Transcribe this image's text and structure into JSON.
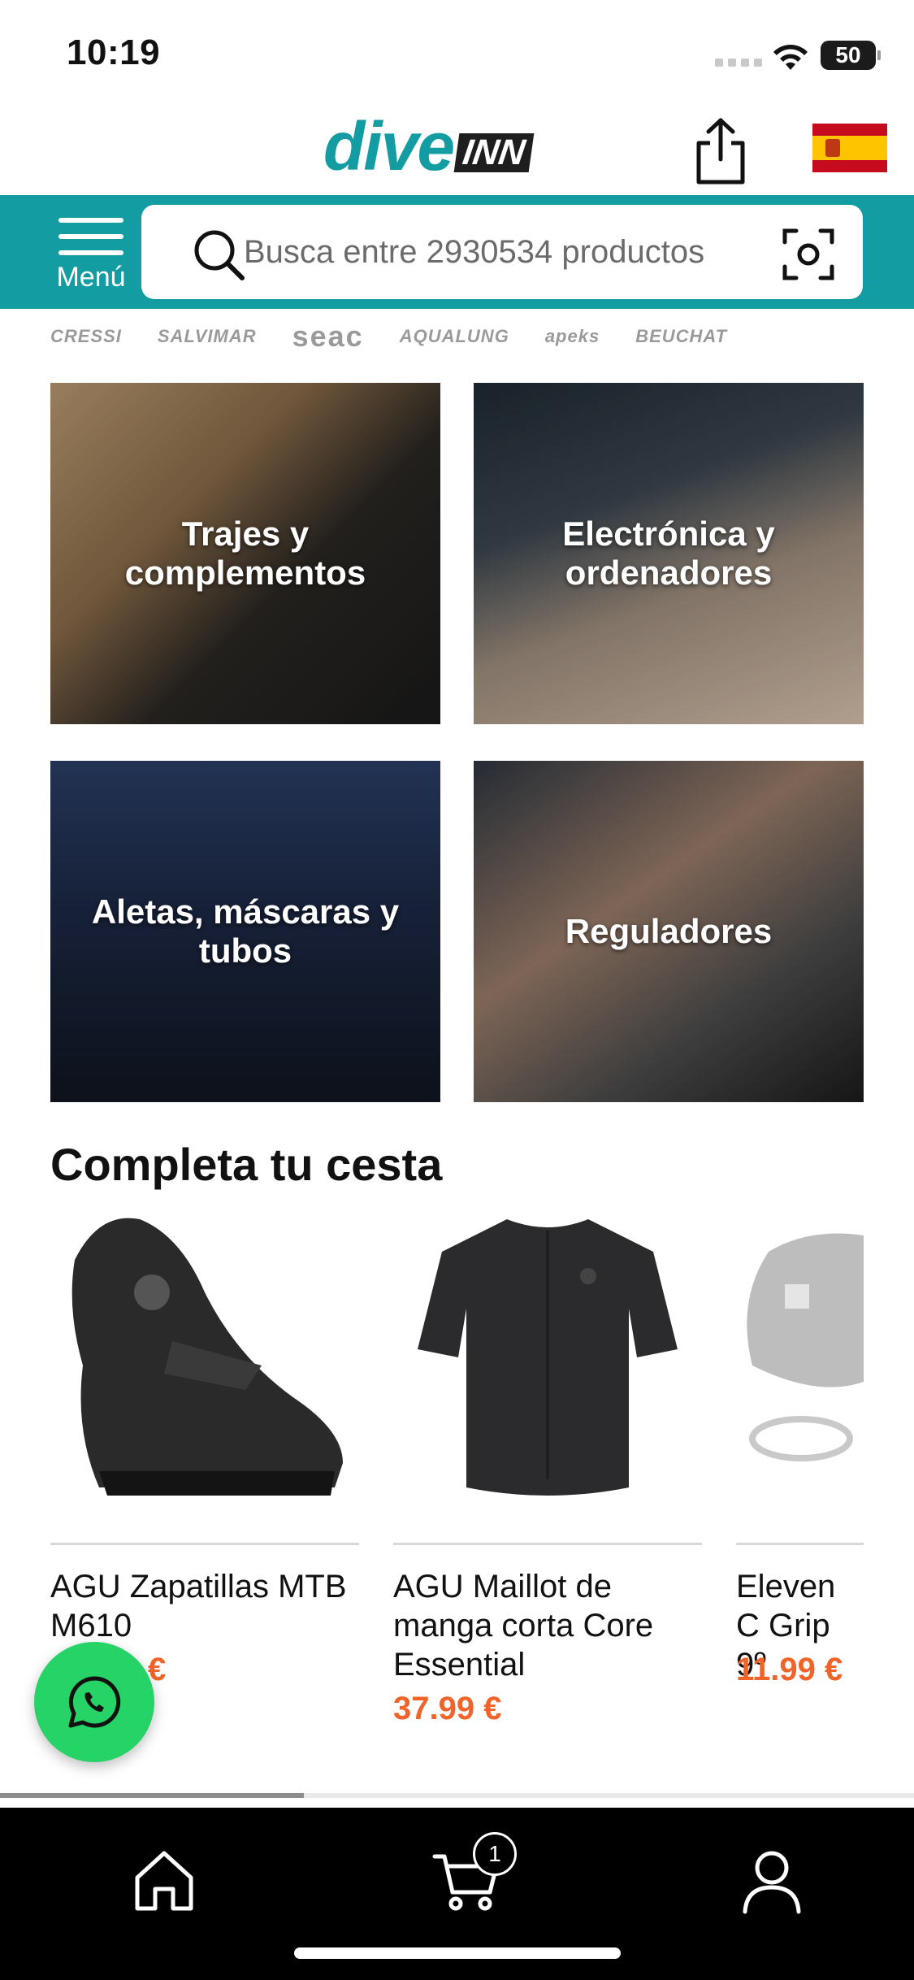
{
  "status_bar": {
    "time": "10:19",
    "battery": "50"
  },
  "header": {
    "logo_primary": "dive",
    "logo_secondary": "INN",
    "share_icon": "share-icon",
    "flag_icon": "spain-flag-icon"
  },
  "search": {
    "menu_label": "Menú",
    "placeholder": "Busca entre 2930534 productos"
  },
  "brands": [
    "CRESSI",
    "SALVIMAR",
    "seac",
    "AQUALUNG",
    "apeks",
    "BEUCHAT"
  ],
  "categories": [
    {
      "label": "Trajes y complementos"
    },
    {
      "label": "Electrónica y ordenadores"
    },
    {
      "label": "Aletas, máscaras y tubos"
    },
    {
      "label": "Reguladores"
    }
  ],
  "section": {
    "title": "Completa tu cesta"
  },
  "products": [
    {
      "name": "AGU Zapatillas MTB M610",
      "price": "€"
    },
    {
      "name": "AGU Maillot de manga corta Core Essential",
      "price": "37.99 €"
    },
    {
      "name": "Eleven C Grip 9º",
      "price": "11.99 €"
    }
  ],
  "bottom_nav": {
    "home_icon": "home-icon",
    "cart_icon": "cart-icon",
    "cart_count": "1",
    "account_icon": "user-icon"
  },
  "colors": {
    "brand_teal": "#139ca1",
    "price_orange": "#f0642a",
    "whatsapp_green": "#25d366"
  }
}
